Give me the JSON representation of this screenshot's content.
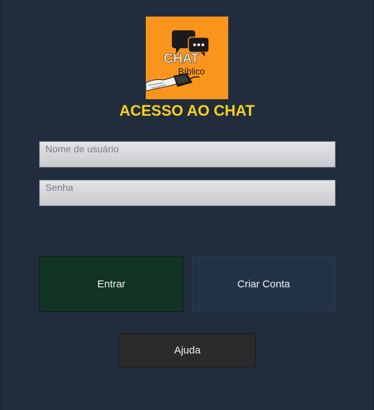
{
  "logo": {
    "chat_text": "CHAT",
    "sub_text": "Bíblico",
    "background_color": "#f9951d"
  },
  "title": "ACESSO AO CHAT",
  "fields": {
    "username_placeholder": "Nome de usuário",
    "password_placeholder": "Senha"
  },
  "buttons": {
    "enter_label": "Entrar",
    "create_account_label": "Criar Conta",
    "help_label": "Ajuda"
  },
  "colors": {
    "background": "#212c3d",
    "title": "#f7d11f",
    "enter_button": "#113425",
    "create_button": "#233247",
    "help_button": "#2b2b2b"
  }
}
